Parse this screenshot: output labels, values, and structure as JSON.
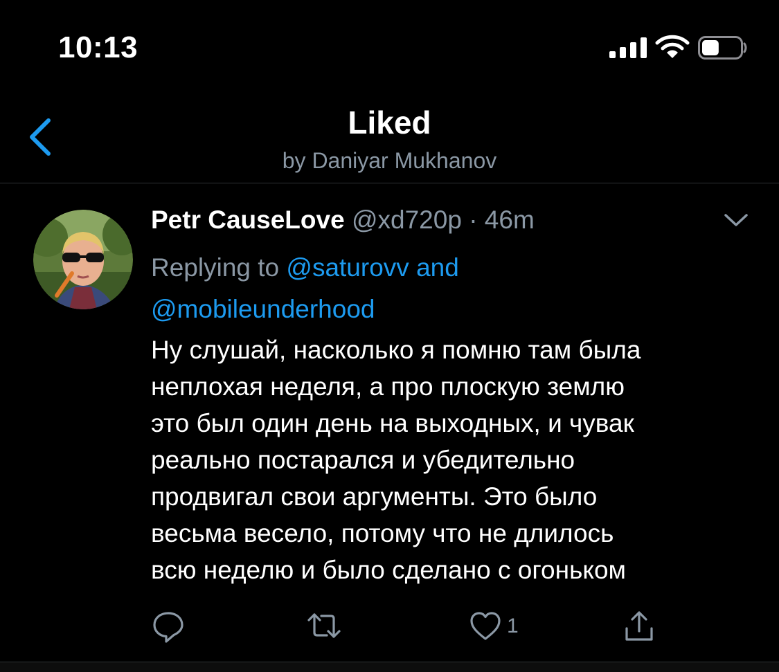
{
  "status_bar": {
    "time": "10:13",
    "battery_level": 0.45
  },
  "header": {
    "title": "Liked",
    "subtitle": "by Daniyar Mukhanov"
  },
  "tweet": {
    "author_name": "Petr CauseLove",
    "handle": "@xd720p",
    "separator": "·",
    "age": "46m",
    "replying_prefix": "Replying to",
    "mention_1": "@saturovv",
    "mention_joiner": "and",
    "mention_2": "@mobileunderhood",
    "body_lines": [
      "Ну слушай, насколько я помню там была",
      "неплохая неделя, а про плоскую землю",
      "это был один день на выходных, и чувак",
      "реально постарался и убедительно",
      "продвигал свои аргументы. Это было",
      "весьма весело, потому что не длилось",
      "всю неделю и было сделано с огоньком"
    ],
    "like_count": "1"
  },
  "icons": {
    "back": "chevron-left-icon",
    "caret": "chevron-down-icon",
    "reply": "reply-icon",
    "retweet": "retweet-icon",
    "like": "heart-icon",
    "share": "share-icon"
  },
  "colors": {
    "accent": "#1d9bf0",
    "muted": "#8b98a5",
    "background": "#000000"
  }
}
